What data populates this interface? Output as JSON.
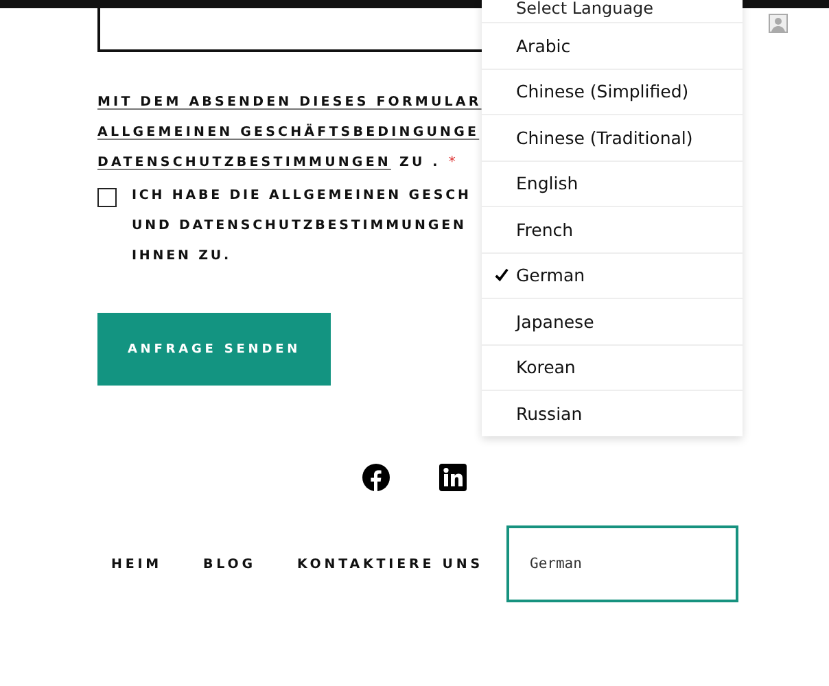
{
  "notice": {
    "lines": [
      "MIT DEM ABSENDEN DIESES FORMULAR",
      "ALLGEMEINEN GESCHÄFTSBEDINGUNGE"
    ],
    "last_link": "DATENSCHUTZBESTIMMUNGEN",
    "tail": "ZU .",
    "required_mark": "*"
  },
  "consent": {
    "checked": false,
    "lines": [
      "ICH HABE DIE ALLGEMEINEN GESCH",
      "UND DATENSCHUTZBESTIMMUNGEN",
      "IHNEN ZU."
    ]
  },
  "submit_button": "ANFRAGE SENDEN",
  "social": [
    {
      "kind": "facebook"
    },
    {
      "kind": "linkedin"
    }
  ],
  "footer_nav": [
    "HEIM",
    "BLOG",
    "KONTAKTIERE UNS"
  ],
  "language_select": {
    "value": "German"
  },
  "language_menu": {
    "header": "Select Language",
    "options": [
      {
        "label": "Arabic",
        "selected": false
      },
      {
        "label": "Chinese (Simplified)",
        "selected": false
      },
      {
        "label": "Chinese (Traditional)",
        "selected": false
      },
      {
        "label": "English",
        "selected": false
      },
      {
        "label": "French",
        "selected": false
      },
      {
        "label": "German",
        "selected": true
      },
      {
        "label": "Japanese",
        "selected": false
      },
      {
        "label": "Korean",
        "selected": false
      },
      {
        "label": "Russian",
        "selected": false
      }
    ]
  }
}
